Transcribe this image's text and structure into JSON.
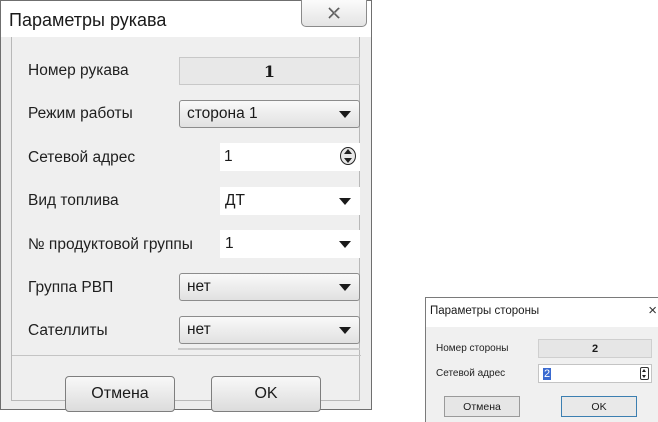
{
  "dialog1": {
    "title": "Параметры рукава",
    "close_icon": "close-icon",
    "fields": {
      "hose_number": {
        "label": "Номер рукава",
        "value": "1"
      },
      "mode": {
        "label": "Режим работы",
        "value": "сторона 1"
      },
      "network_address": {
        "label": "Сетевой адрес",
        "value": "1"
      },
      "fuel_type": {
        "label": "Вид топлива",
        "value": "ДТ"
      },
      "product_group": {
        "label": "№ продуктовой группы",
        "value": "1"
      },
      "rvp_group": {
        "label": "Группа РВП",
        "value": "нет"
      },
      "satellites": {
        "label": "Сателлиты",
        "value": "нет"
      }
    },
    "buttons": {
      "cancel": "Отмена",
      "ok": "OK"
    }
  },
  "dialog2": {
    "title": "Параметры стороны",
    "close_glyph": "×",
    "fields": {
      "side_number": {
        "label": "Номер стороны",
        "value": "2"
      },
      "network_address": {
        "label": "Сетевой адрес",
        "value": "2"
      }
    },
    "buttons": {
      "cancel": "Отмена",
      "ok": "OK"
    },
    "accent_color": "#3c7fb1"
  }
}
